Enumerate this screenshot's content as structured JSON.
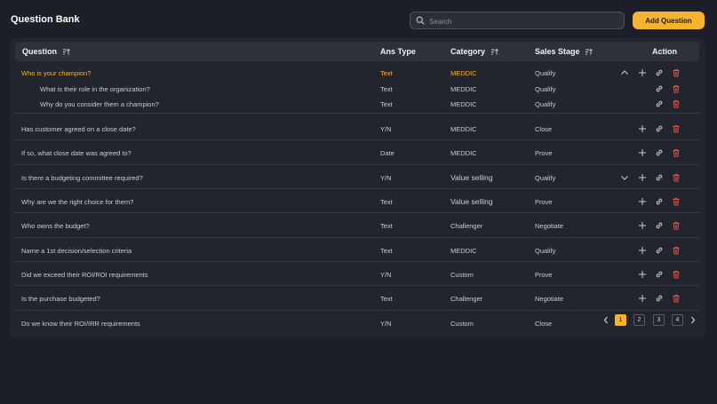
{
  "header": {
    "title": "Question Bank",
    "search_placeholder": "Search",
    "add_button": "Add Question"
  },
  "table": {
    "columns": {
      "question": "Question",
      "ans_type": "Ans Type",
      "category": "Category",
      "sales_stage": "Sales Stage",
      "action": "Action"
    },
    "rows": [
      {
        "question": "Who is your champion?",
        "ans_type": "Text",
        "category": "MEDDIC",
        "stage": "Qualify",
        "expand": "up",
        "add": true,
        "active": true
      },
      {
        "question": "What is their role in the organization?",
        "ans_type": "Text",
        "category": "MEDDIC",
        "stage": "Qualify",
        "expand": "",
        "add": false,
        "child": true
      },
      {
        "question": "Why do you consider them a champion?",
        "ans_type": "Text",
        "category": "MEDDIC",
        "stage": "Qualify",
        "expand": "",
        "add": false,
        "child": true
      },
      {
        "question": "Has customer agreed on a close date?",
        "ans_type": "Y/N",
        "category": "MEDDIC",
        "stage": "Close",
        "expand": "",
        "add": true
      },
      {
        "question": "If so, what close date was agreed to?",
        "ans_type": "Date",
        "category": "MEDDIC",
        "stage": "Prove",
        "expand": "",
        "add": true
      },
      {
        "question": "Is there a budgeting committee required?",
        "ans_type": "Y/N",
        "category": "Value selling",
        "stage": "Qualify",
        "expand": "down",
        "add": true
      },
      {
        "question": "Why are we the right choice for them?",
        "ans_type": "Text",
        "category": "Value selling",
        "stage": "Prove",
        "expand": "",
        "add": true
      },
      {
        "question": "Who owns the budget?",
        "ans_type": "Text",
        "category": "Challenger",
        "stage": "Negotiate",
        "expand": "",
        "add": true
      },
      {
        "question": "Name a 1st decision/selection criteria",
        "ans_type": "Text",
        "category": "MEDDIC",
        "stage": "Qualify",
        "expand": "",
        "add": true
      },
      {
        "question": "Did we exceed their ROI/ROI requirements",
        "ans_type": "Y/N",
        "category": "Custom",
        "stage": "Prove",
        "expand": "",
        "add": true
      },
      {
        "question": "Is the purchase budgeted?",
        "ans_type": "Text",
        "category": "Challenger",
        "stage": "Negotiate",
        "expand": "",
        "add": true
      },
      {
        "question": "Do we know their ROI/IRR requirements",
        "ans_type": "Y/N",
        "category": "Custom",
        "stage": "Close",
        "expand": "",
        "add": false,
        "no_actions": true
      }
    ]
  },
  "pagination": {
    "current": "1",
    "pages": [
      "1",
      "2",
      "3",
      "4"
    ]
  },
  "colors": {
    "accent": "#f5b330",
    "delete": "#e0524a",
    "background": "#1c1f27",
    "panel": "#22252d"
  }
}
